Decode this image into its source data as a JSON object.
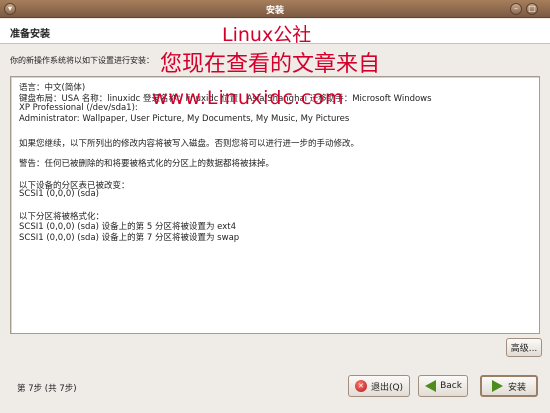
{
  "window": {
    "title": "安装"
  },
  "header": {
    "title": "准备安装"
  },
  "watermark": {
    "line1": "Linux公社",
    "line2": "您现在查看的文章来自",
    "line3": "www.Linuxidc.com"
  },
  "intro_text": "你的新操作系统将以如下设置进行安装：",
  "summary": {
    "lines": [
      "语言：中文(简体)",
      "键盘布局：USA 名称：linuxidc 登录名称：linuxidc 位置：Asia/Shanghai 迁移助手：Microsoft Windows",
      "XP Professional (/dev/sda1):",
      " Administrator: Wallpaper, User Picture, My Documents, My Music, My Pictures",
      "如果您继续，以下所列出的修改内容将被写入磁盘。否则您将可以进行进一步的手动修改。",
      "警告：任何已被删除的和将要被格式化的分区上的数据都将被抹掉。",
      "以下设备的分区表已被改变：",
      " SCSI1 (0,0,0) (sda)",
      "以下分区将被格式化：",
      " SCSI1 (0,0,0) (sda) 设备上的第 5 分区将被设置为 ext4",
      " SCSI1 (0,0,0) (sda) 设备上的第 7 分区将被设置为 swap"
    ]
  },
  "buttons": {
    "advanced": "高级...",
    "quit": "退出(Q)",
    "back": "Back",
    "install": "安装"
  },
  "step_label": "第 7步 (共 7步)"
}
